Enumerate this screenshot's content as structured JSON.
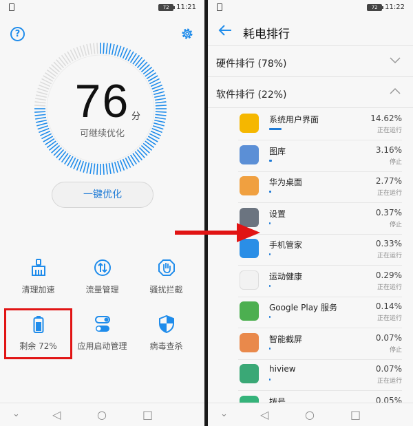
{
  "left": {
    "status": {
      "sim": "",
      "battery": "72",
      "time": "11:21"
    },
    "score": "76",
    "score_unit": "分",
    "caption": "可继续优化",
    "optimize_button": "一键优化",
    "tools": [
      {
        "label": "清理加速",
        "icon": "broom-icon"
      },
      {
        "label": "流量管理",
        "icon": "data-usage-icon"
      },
      {
        "label": "骚扰拦截",
        "icon": "hand-block-icon"
      },
      {
        "label": "剩余 72%",
        "icon": "battery-icon"
      },
      {
        "label": "应用启动管理",
        "icon": "toggle-icon"
      },
      {
        "label": "病毒查杀",
        "icon": "shield-icon"
      }
    ],
    "accent": "#1f8ceb"
  },
  "right": {
    "status": {
      "battery": "72",
      "time": "11:22"
    },
    "title": "耗电排行",
    "hardware_section": "硬件排行 (78%)",
    "software_section": "软件排行 (22%)",
    "apps": [
      {
        "name": "系统用户界面",
        "percent": "14.62%",
        "status": "正在运行",
        "fraction": 0.1462,
        "color": "#f5b700"
      },
      {
        "name": "图库",
        "percent": "3.16%",
        "status": "停止",
        "fraction": 0.0316,
        "color": "#5b8fd6"
      },
      {
        "name": "华为桌面",
        "percent": "2.77%",
        "status": "正在运行",
        "fraction": 0.0277,
        "color": "#f0a040"
      },
      {
        "name": "设置",
        "percent": "0.37%",
        "status": "停止",
        "fraction": 0.0037,
        "color": "#6b7480"
      },
      {
        "name": "手机管家",
        "percent": "0.33%",
        "status": "正在运行",
        "fraction": 0.0033,
        "color": "#2a8ee6"
      },
      {
        "name": "运动健康",
        "percent": "0.29%",
        "status": "正在运行",
        "fraction": 0.0029,
        "color": "#f2f2f2"
      },
      {
        "name": "Google Play 服务",
        "percent": "0.14%",
        "status": "正在运行",
        "fraction": 0.0014,
        "color": "#4caf50"
      },
      {
        "name": "智能截屏",
        "percent": "0.07%",
        "status": "停止",
        "fraction": 0.0007,
        "color": "#e9894b"
      },
      {
        "name": "hiview",
        "percent": "0.07%",
        "status": "正在运行",
        "fraction": 0.0007,
        "color": "#3aa876"
      },
      {
        "name": "拨号",
        "percent": "0.05%",
        "status": "",
        "fraction": 0.0005,
        "color": "#35b37a"
      }
    ]
  }
}
